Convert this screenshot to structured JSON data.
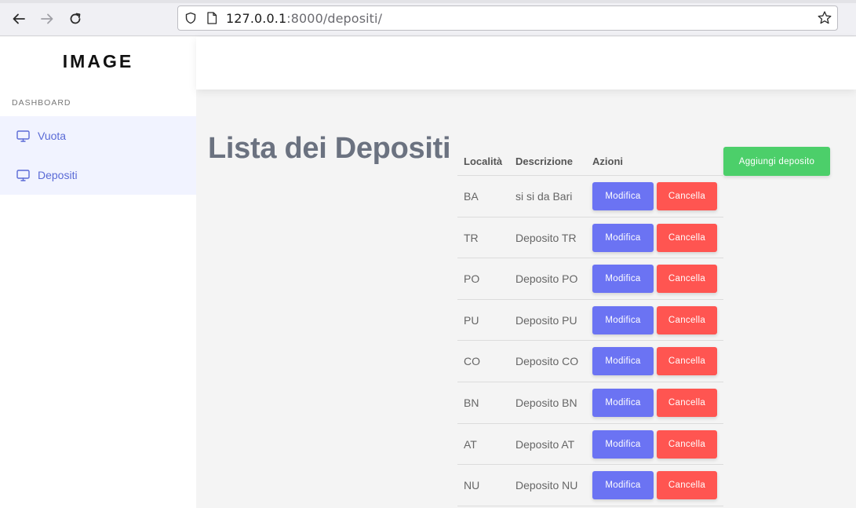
{
  "browser": {
    "url_host": "127.0.0.1",
    "url_path": ":8000/depositi/"
  },
  "sidebar": {
    "brand": "IMAGE",
    "section_label": "DASHBOARD",
    "items": [
      {
        "label": "Vuota"
      },
      {
        "label": "Depositi"
      }
    ]
  },
  "main": {
    "title": "Lista dei Depositi",
    "add_label": "Aggiungi deposito",
    "columns": [
      "Località",
      "Descrizione",
      "Azioni"
    ],
    "edit_label": "Modifica",
    "delete_label": "Cancella",
    "rows": [
      {
        "loc": "BA",
        "desc": "si si da Bari"
      },
      {
        "loc": "TR",
        "desc": "Deposito TR"
      },
      {
        "loc": "PO",
        "desc": "Deposito PO"
      },
      {
        "loc": "PU",
        "desc": "Deposito PU"
      },
      {
        "loc": "CO",
        "desc": "Deposito CO"
      },
      {
        "loc": "BN",
        "desc": "Deposito BN"
      },
      {
        "loc": "AT",
        "desc": "Deposito AT"
      },
      {
        "loc": "NU",
        "desc": "Deposito NU"
      }
    ]
  },
  "colors": {
    "edit": "#6b73f3",
    "delete": "#ff5551",
    "add": "#4ccf6a",
    "menu_text": "#5a6ad6"
  },
  "icons": {
    "back": "back-arrow-icon",
    "forward": "forward-arrow-icon",
    "reload": "reload-icon",
    "shield": "shield-icon",
    "page": "page-icon",
    "star": "star-icon",
    "monitor": "monitor-icon"
  }
}
